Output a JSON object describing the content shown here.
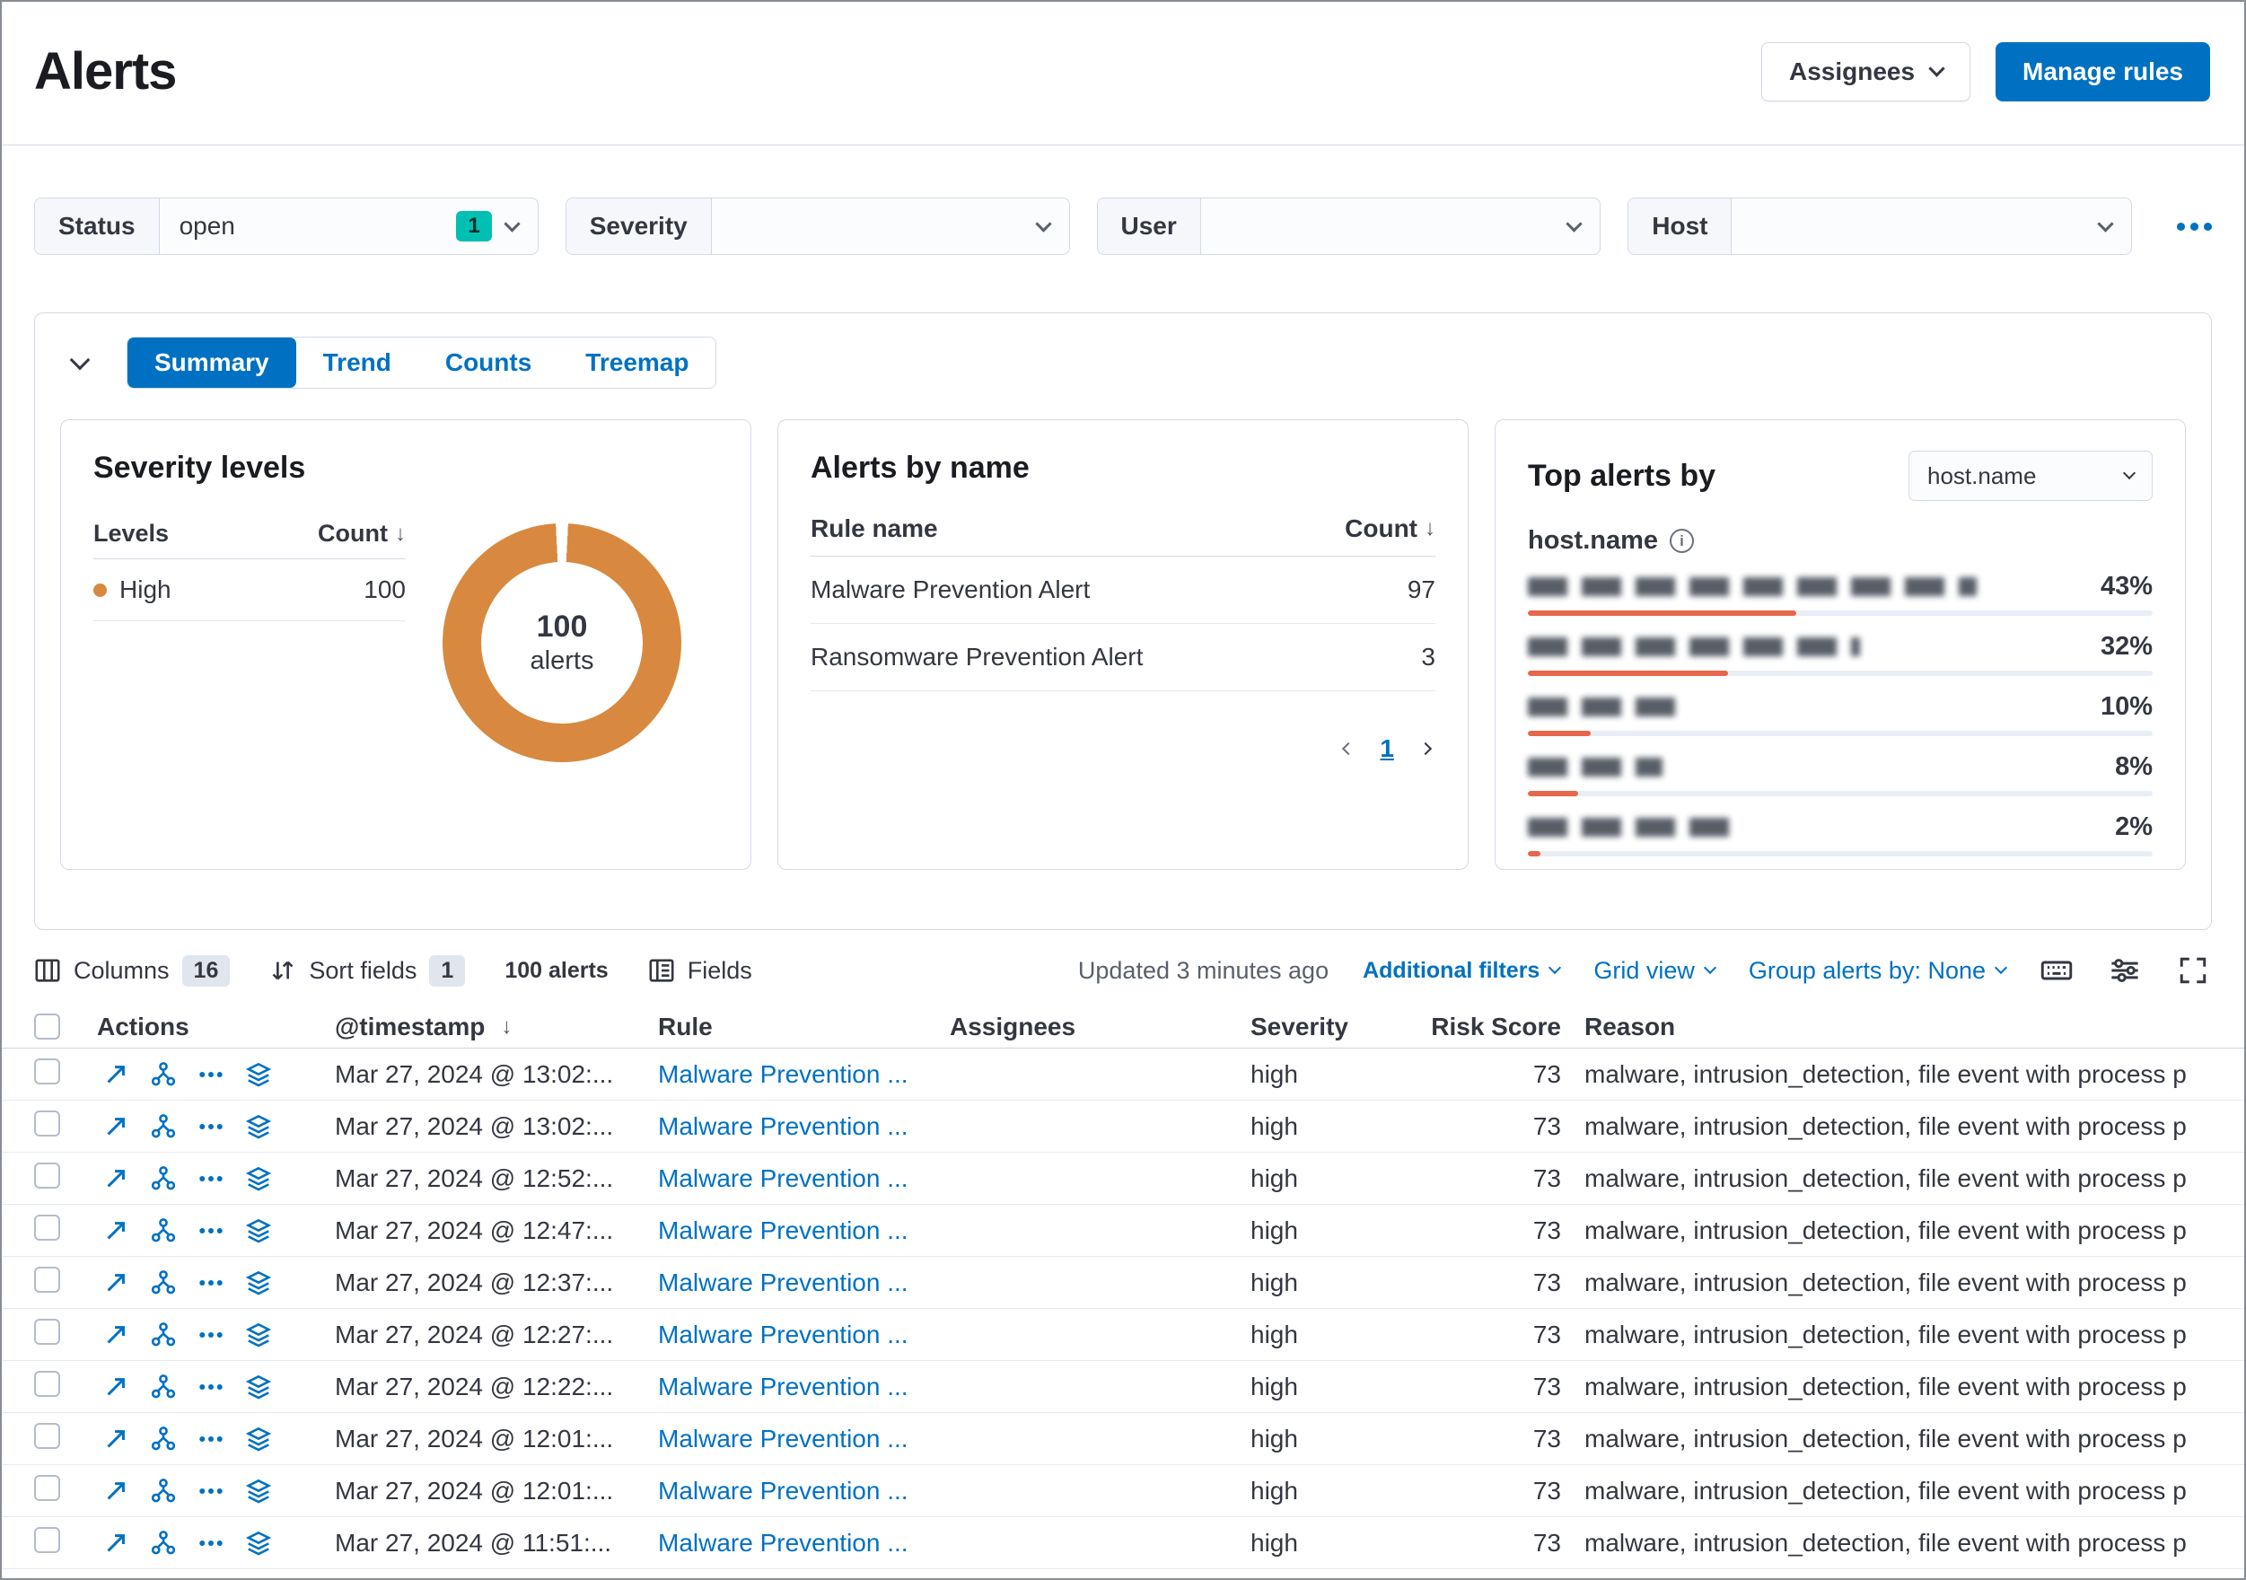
{
  "page": {
    "title": "Alerts"
  },
  "header": {
    "assignees_button": "Assignees",
    "manage_rules_button": "Manage rules"
  },
  "filters": {
    "status": {
      "label": "Status",
      "value": "open",
      "selected_count": "1"
    },
    "severity": {
      "label": "Severity",
      "value": ""
    },
    "user": {
      "label": "User",
      "value": ""
    },
    "host": {
      "label": "Host",
      "value": ""
    }
  },
  "charts": {
    "tabs": [
      {
        "label": "Summary",
        "active": true
      },
      {
        "label": "Trend",
        "active": false
      },
      {
        "label": "Counts",
        "active": false
      },
      {
        "label": "Treemap",
        "active": false
      }
    ],
    "severity_panel": {
      "title": "Severity levels",
      "col_levels": "Levels",
      "col_count": "Count",
      "rows": [
        {
          "level": "High",
          "count": "100"
        }
      ],
      "donut_value": "100",
      "donut_unit": "alerts"
    },
    "alerts_by_name_panel": {
      "title": "Alerts by name",
      "col_rule": "Rule name",
      "col_count": "Count",
      "rows": [
        {
          "rule": "Malware Prevention Alert",
          "count": "97"
        },
        {
          "rule": "Ransomware Prevention Alert",
          "count": "3"
        }
      ],
      "current_page": "1"
    },
    "top_alerts_panel": {
      "title": "Top alerts by",
      "field_selector": "host.name",
      "field_label": "host.name",
      "items": [
        {
          "pct": "43%"
        },
        {
          "pct": "32%"
        },
        {
          "pct": "10%"
        },
        {
          "pct": "8%"
        },
        {
          "pct": "2%"
        }
      ]
    }
  },
  "chart_data": [
    {
      "type": "pie",
      "title": "Severity levels",
      "categories": [
        "High"
      ],
      "values": [
        100
      ],
      "center_label": "100 alerts",
      "color": "#d8893f"
    },
    {
      "type": "bar",
      "title": "Top alerts by host.name",
      "categories": [
        "redacted-host-1",
        "redacted-host-2",
        "redacted-host-3",
        "redacted-host-4",
        "redacted-host-5"
      ],
      "values": [
        43,
        32,
        10,
        8,
        2
      ],
      "unit": "%",
      "color": "#e7664c"
    }
  ],
  "toolbar": {
    "columns_label": "Columns",
    "columns_count": "16",
    "sort_label": "Sort fields",
    "sort_count": "1",
    "alerts_count": "100 alerts",
    "fields_label": "Fields",
    "updated": "Updated 3 minutes ago",
    "additional_filters": "Additional filters",
    "grid_view": "Grid view",
    "group_by": "Group alerts by: None"
  },
  "table": {
    "headers": {
      "actions": "Actions",
      "timestamp": "@timestamp",
      "rule": "Rule",
      "assignees": "Assignees",
      "severity": "Severity",
      "risk_score": "Risk Score",
      "reason": "Reason"
    },
    "rows": [
      {
        "timestamp": "Mar 27, 2024 @ 13:02:...",
        "rule": "Malware Prevention ...",
        "severity": "high",
        "risk_score": "73",
        "reason": "malware, intrusion_detection, file event with process p"
      },
      {
        "timestamp": "Mar 27, 2024 @ 13:02:...",
        "rule": "Malware Prevention ...",
        "severity": "high",
        "risk_score": "73",
        "reason": "malware, intrusion_detection, file event with process p"
      },
      {
        "timestamp": "Mar 27, 2024 @ 12:52:...",
        "rule": "Malware Prevention ...",
        "severity": "high",
        "risk_score": "73",
        "reason": "malware, intrusion_detection, file event with process p"
      },
      {
        "timestamp": "Mar 27, 2024 @ 12:47:...",
        "rule": "Malware Prevention ...",
        "severity": "high",
        "risk_score": "73",
        "reason": "malware, intrusion_detection, file event with process p"
      },
      {
        "timestamp": "Mar 27, 2024 @ 12:37:...",
        "rule": "Malware Prevention ...",
        "severity": "high",
        "risk_score": "73",
        "reason": "malware, intrusion_detection, file event with process p"
      },
      {
        "timestamp": "Mar 27, 2024 @ 12:27:...",
        "rule": "Malware Prevention ...",
        "severity": "high",
        "risk_score": "73",
        "reason": "malware, intrusion_detection, file event with process p"
      },
      {
        "timestamp": "Mar 27, 2024 @ 12:22:...",
        "rule": "Malware Prevention ...",
        "severity": "high",
        "risk_score": "73",
        "reason": "malware, intrusion_detection, file event with process p"
      },
      {
        "timestamp": "Mar 27, 2024 @ 12:01:...",
        "rule": "Malware Prevention ...",
        "severity": "high",
        "risk_score": "73",
        "reason": "malware, intrusion_detection, file event with process p"
      },
      {
        "timestamp": "Mar 27, 2024 @ 12:01:...",
        "rule": "Malware Prevention ...",
        "severity": "high",
        "risk_score": "73",
        "reason": "malware, intrusion_detection, file event with process p"
      },
      {
        "timestamp": "Mar 27, 2024 @ 11:51:...",
        "rule": "Malware Prevention ...",
        "severity": "high",
        "risk_score": "73",
        "reason": "malware, intrusion_detection, file event with process p"
      }
    ]
  }
}
